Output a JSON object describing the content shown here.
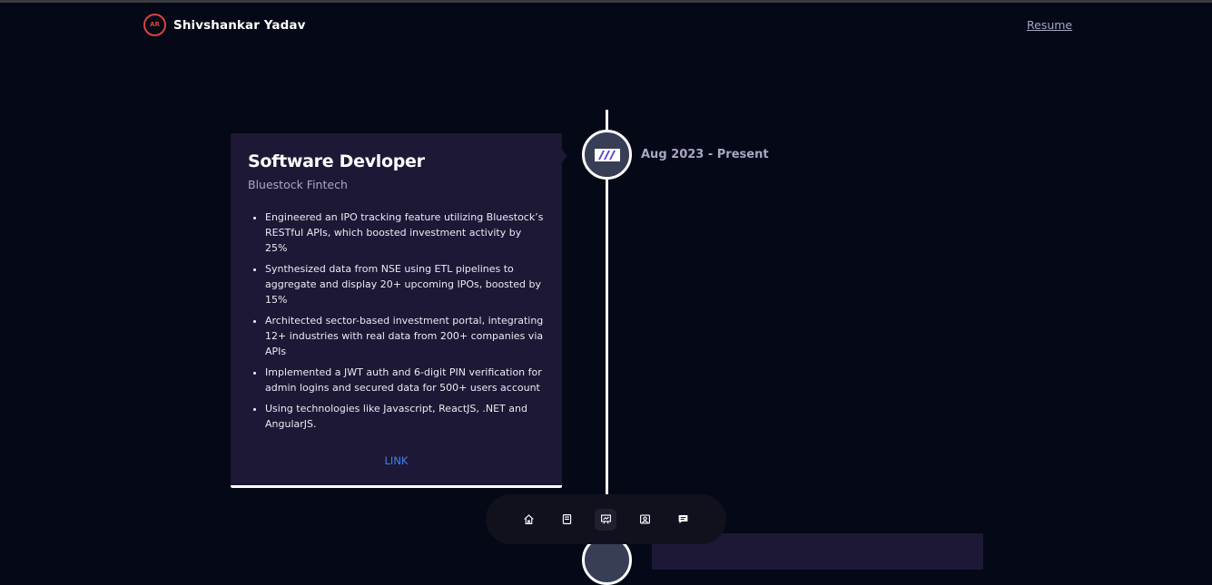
{
  "brand": {
    "logo_text": "AR",
    "name": "Shivshankar Yadav"
  },
  "nav": {
    "resume_label": "Resume"
  },
  "experience": {
    "title": "Software Devloper",
    "company": "Bluestock Fintech",
    "date": "Aug 2023 - Present",
    "points": [
      "Engineered an IPO tracking feature utilizing Bluestock’s RESTful APIs, which boosted investment activity by 25%",
      "Synthesized data from NSE using ETL pipelines to aggregate and display 20+ upcoming IPOs, boosted by 15%",
      "Architected sector-based investment portal, integrating 12+ industries with real data from 200+ companies via APIs",
      "Implemented a JWT auth and 6-digit PIN verification for admin logins and secured data for 500+ users account",
      "Using technologies like Javascript, ReactJS, .NET and AngularJS."
    ],
    "link_label": "LINK",
    "icon": "company-logo-icon"
  },
  "dock": {
    "items": [
      {
        "icon": "home-icon"
      },
      {
        "icon": "book-icon"
      },
      {
        "icon": "presentation-icon"
      },
      {
        "icon": "contact-card-icon"
      },
      {
        "icon": "message-icon"
      }
    ]
  },
  "colors": {
    "background": "#050816",
    "card": "#1d1836",
    "secondary_text": "#aaa6c3",
    "link": "#3b82f6",
    "logo": "#d8453c"
  }
}
